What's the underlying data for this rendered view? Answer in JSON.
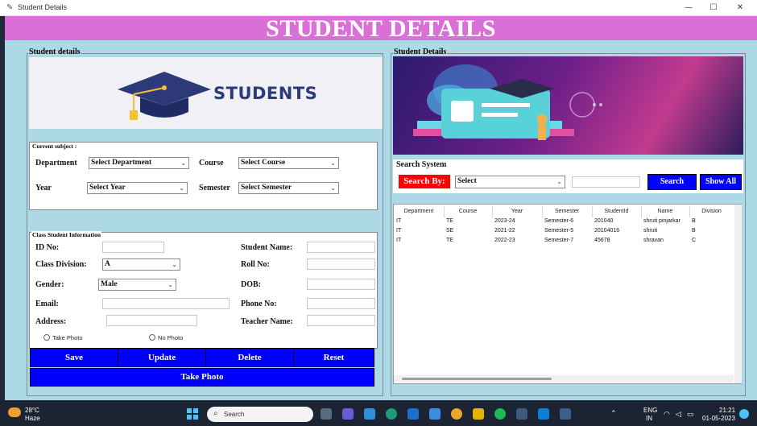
{
  "window": {
    "title": "Student Details",
    "minimize": "—",
    "maximize": "☐",
    "close": "✕"
  },
  "header": {
    "title": "STUDENT DETAILS"
  },
  "left": {
    "frame_title": "Student details",
    "logo_text": "STUDENTS",
    "current_subject": {
      "title": "Current subject :",
      "department_label": "Department",
      "department_value": "Select Department",
      "course_label": "Course",
      "course_value": "Select Course",
      "year_label": "Year",
      "year_value": "Select Year",
      "semester_label": "Semester",
      "semester_value": "Select Semester"
    },
    "class_info": {
      "title": "Class Student Information",
      "id_label": "ID No:",
      "student_name_label": "Student Name:",
      "class_division_label": "Class Division:",
      "class_division_value": "A",
      "roll_no_label": "Roll No:",
      "gender_label": "Gender:",
      "gender_value": "Male",
      "dob_label": "DOB:",
      "email_label": "Email:",
      "phone_label": "Phone No:",
      "address_label": "Address:",
      "teacher_label": "Teacher Name:",
      "take_photo_radio": "Take Photo",
      "no_photo_radio": "No Photo"
    },
    "buttons": {
      "save": "Save",
      "update": "Update",
      "delete": "Delete",
      "reset": "Reset",
      "take_photo": "Take Photo"
    }
  },
  "right": {
    "frame_title": "Student Details",
    "search": {
      "title": "Search System",
      "search_by": "Search By:",
      "select_value": "Select",
      "search_button": "Search",
      "show_all_button": "Show All"
    },
    "table": {
      "columns": [
        "Department",
        "Course",
        "Year",
        "Semester",
        "StudentId",
        "Name",
        "Division"
      ],
      "rows": [
        [
          "IT",
          "TE",
          "2023-24",
          "Semester-6",
          "201040",
          "shruti pinjarkar",
          "B"
        ],
        [
          "IT",
          "SE",
          "2021-22",
          "Semester-5",
          "20104016",
          "shruti",
          "B"
        ],
        [
          "IT",
          "TE",
          "2022-23",
          "Semester-7",
          "45678",
          "shravan",
          "C"
        ]
      ]
    }
  },
  "taskbar": {
    "temperature": "28°C",
    "weather": "Haze",
    "search_placeholder": "Search",
    "language": "ENG",
    "region": "IN",
    "time": "21:21",
    "date": "01-05-2023"
  },
  "colors": {
    "header": "#da70d6",
    "background": "#add8e6",
    "button": "#0000ff",
    "search_by": "#ff0000"
  }
}
